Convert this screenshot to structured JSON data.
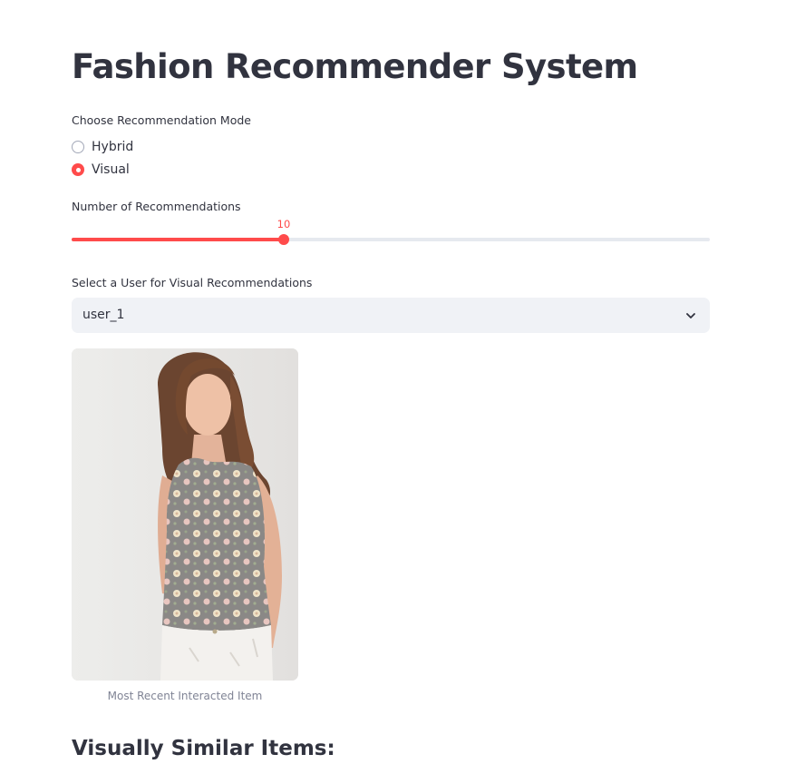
{
  "app": {
    "title": "Fashion Recommender System"
  },
  "mode": {
    "label": "Choose Recommendation Mode",
    "options": [
      {
        "label": "Hybrid",
        "selected": false
      },
      {
        "label": "Visual",
        "selected": true
      }
    ]
  },
  "slider": {
    "label": "Number of Recommendations",
    "value": "10",
    "fill_fraction": 0.333
  },
  "user_select": {
    "label": "Select a User for Visual Recommendations",
    "value": "user_1"
  },
  "recent_item": {
    "caption": "Most Recent Interacted Item"
  },
  "results": {
    "heading": "Visually Similar Items:"
  },
  "colors": {
    "accent": "#ff4b4b",
    "text": "#31333f",
    "muted": "#808495",
    "input_bg": "#f0f2f6",
    "track": "#e6e9ef"
  },
  "icons": {
    "select_chevron": "chevron-down-icon"
  }
}
